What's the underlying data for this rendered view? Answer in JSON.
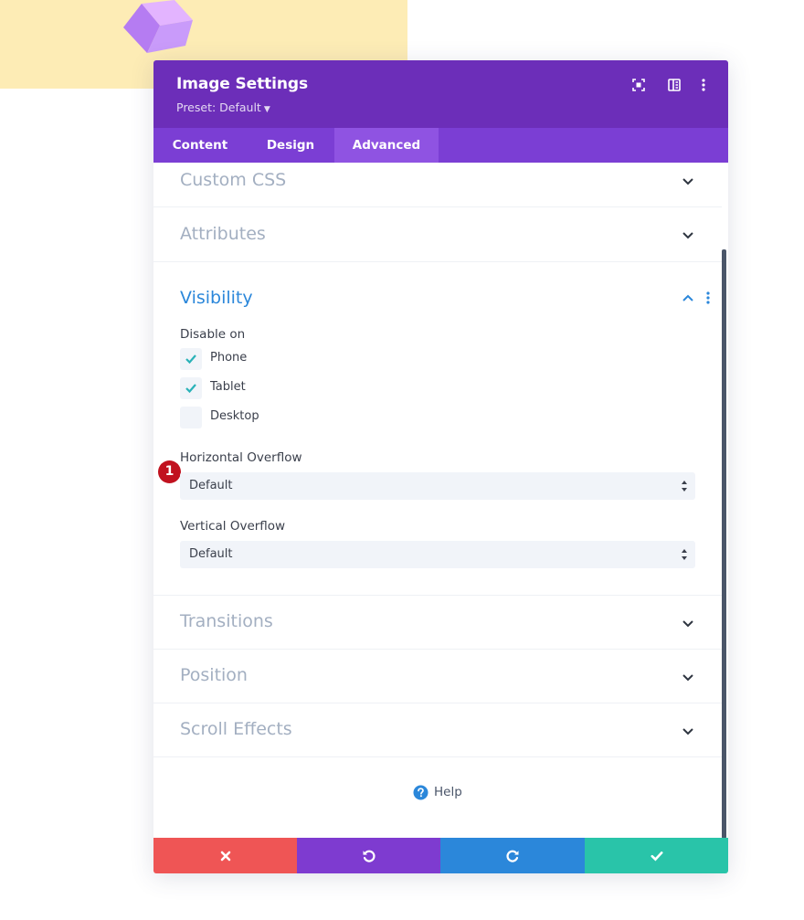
{
  "modal": {
    "title": "Image Settings",
    "preset_label": "Preset: Default"
  },
  "tabs": [
    {
      "label": "Content"
    },
    {
      "label": "Design"
    },
    {
      "label": "Advanced"
    }
  ],
  "sections": {
    "custom_css": "Custom CSS",
    "attributes": "Attributes",
    "visibility": "Visibility",
    "transitions": "Transitions",
    "position": "Position",
    "scroll_effects": "Scroll Effects"
  },
  "visibility": {
    "disable_on_label": "Disable on",
    "options": [
      {
        "label": "Phone",
        "checked": true
      },
      {
        "label": "Tablet",
        "checked": true
      },
      {
        "label": "Desktop",
        "checked": false
      }
    ],
    "badge": "1",
    "horizontal_overflow": {
      "label": "Horizontal Overflow",
      "value": "Default"
    },
    "vertical_overflow": {
      "label": "Vertical Overflow",
      "value": "Default"
    }
  },
  "help": {
    "label": "Help"
  },
  "colors": {
    "header": "#6c2eb9",
    "tabs": "#7b3ed4",
    "active_tab": "#8f53e2",
    "check": "#2ab2b8",
    "cancel": "#ef5555",
    "undo": "#7e3bd0",
    "redo": "#2b87da",
    "save": "#29c4a9"
  }
}
